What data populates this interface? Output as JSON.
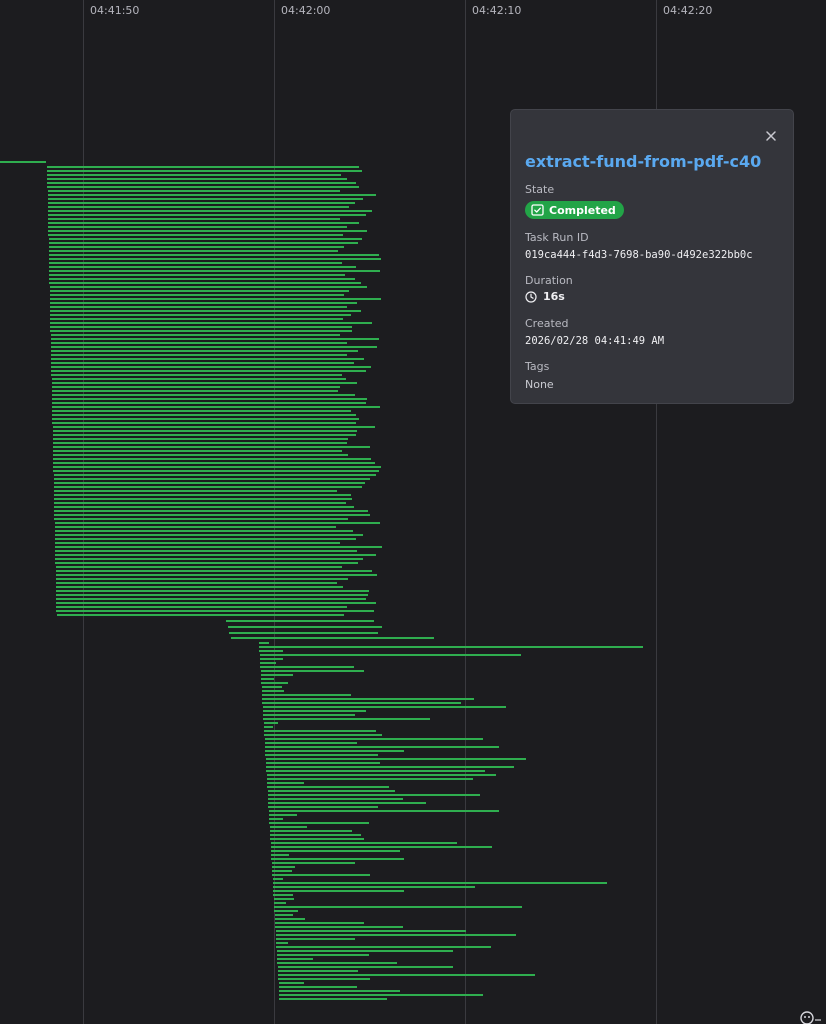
{
  "timeline": {
    "ticks": [
      "04:41:50",
      "04:42:00",
      "04:42:10",
      "04:42:20"
    ],
    "bar_color": "#2fae4f"
  },
  "popover": {
    "close_icon": "close-icon",
    "title": "extract-fund-from-pdf-c40",
    "state_label": "State",
    "state_value": "Completed",
    "state_icon": "check-square-icon",
    "state_color": "#22a447",
    "task_run_id_label": "Task Run ID",
    "task_run_id_value": "019ca444-f4d3-7698-ba90-d492e322bb0c",
    "duration_label": "Duration",
    "duration_value": "16s",
    "duration_icon": "clock-icon",
    "created_label": "Created",
    "created_value": "2026/02/28 04:41:49 AM",
    "tags_label": "Tags",
    "tags_value": "None"
  },
  "footer": {
    "corner_icon": "assistant-icon"
  }
}
